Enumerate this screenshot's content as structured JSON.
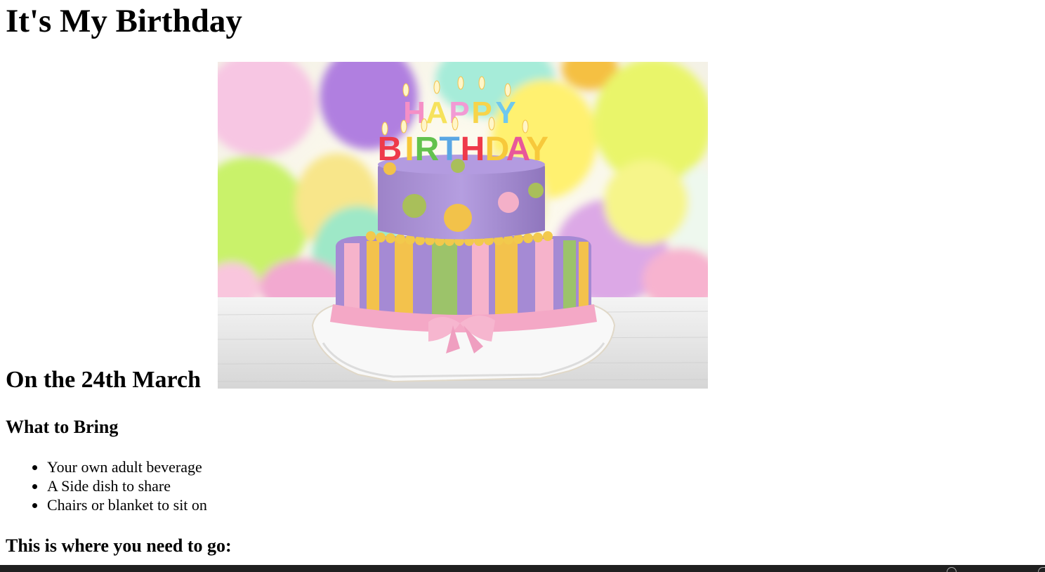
{
  "page": {
    "title": "It's My Birthday",
    "date_heading": "On the 24th March",
    "image": {
      "alt": "Happy Birthday cake with candles and balloons",
      "candle_text_top": "HAPPY",
      "candle_text_bottom": "BIRTHDAY"
    },
    "what_to_bring": {
      "heading": "What to Bring",
      "items": [
        "Your own adult beverage",
        "A Side dish to share",
        "Chairs or blanket to sit on"
      ]
    },
    "where_heading": "This is where you need to go:"
  },
  "colors": {
    "background": "#ffffff",
    "text": "#000000",
    "taskbar": "#202020"
  }
}
